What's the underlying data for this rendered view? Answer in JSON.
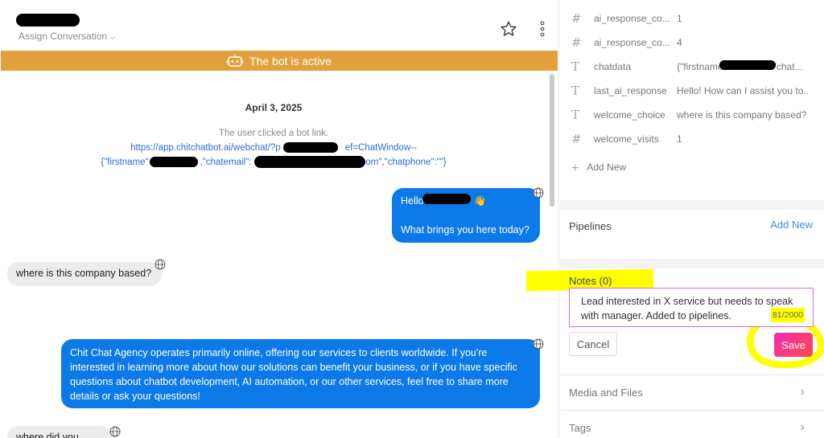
{
  "chat": {
    "assign_label": "Assign Conversation",
    "bot_banner": "The bot is active",
    "date_label": "April 3, 2025",
    "system_text": "The user clicked a bot link.",
    "link_line_1": "https://app.chitchatbot.ai/webchat/?p",
    "link_line_1_b": "ef=ChatWindow--",
    "link_line_2_a": "{\"firstname\"",
    "link_line_2_b": ",\"chatemail\":",
    "link_line_2_c": "om\",\"chatphone\":\"\"}",
    "messages": [
      {
        "dir": "out",
        "line1": "Hello",
        "emoji": "👋",
        "line2": "What brings you here today?"
      },
      {
        "dir": "in",
        "text": "where is this company based?"
      },
      {
        "dir": "out",
        "text": "Chit Chat Agency operates primarily online, offering our services to clients worldwide. If you're interested in learning more about how our solutions can benefit your business, or if you have specific questions about chatbot development, AI automation, or our other services, feel free to share more details or ask your questions!"
      },
      {
        "dir": "in",
        "text": "where did you start?"
      }
    ]
  },
  "sidebar": {
    "fields": [
      {
        "type_icon": "#",
        "name": "ai_response_co...",
        "value": "1"
      },
      {
        "type_icon": "#",
        "name": "ai_response_co...",
        "value": "4"
      },
      {
        "type_icon": "T",
        "name": "chatdata",
        "value": "{\"firstname",
        "value_b": "\"chat..."
      },
      {
        "type_icon": "T",
        "name": "last_ai_response",
        "value": "Hello! How can I assist you to..."
      },
      {
        "type_icon": "T",
        "name": "welcome_choice",
        "value": "where is this company based?"
      },
      {
        "type_icon": "#",
        "name": "welcome_visits",
        "value": "1"
      }
    ],
    "add_new_field": "Add New",
    "pipelines_title": "Pipelines",
    "pipelines_add": "Add New",
    "notes_title": "Notes (0)",
    "notes_text": "Lead interested in X service but needs to speak with manager. Added to pipelines.",
    "notes_counter": "81/2000",
    "cancel_label": "Cancel",
    "save_label": "Save",
    "media_label": "Media and Files",
    "tags_label": "Tags"
  },
  "colors": {
    "banner": "#e3a13d",
    "bubble_out": "#0b7ae8",
    "bubble_in": "#ececec",
    "link": "#2b6cd8",
    "add_new": "#3b8de0",
    "highlight": "#ffff00",
    "notes_border": "#d46bd6"
  }
}
